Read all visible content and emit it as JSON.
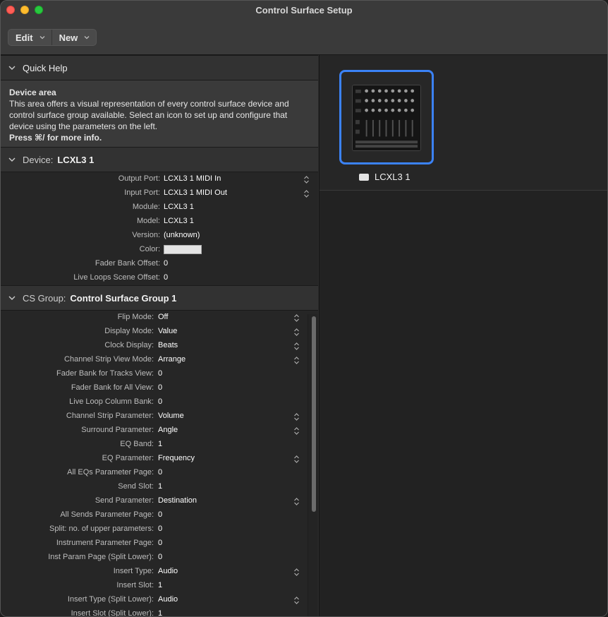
{
  "window": {
    "title": "Control Surface Setup"
  },
  "toolbar": {
    "edit_label": "Edit",
    "new_label": "New"
  },
  "quick_help": {
    "header": "Quick Help",
    "title": "Device area",
    "body": "This area offers a visual representation of every control surface device and control surface group available. Select an icon to set up and configure that device using the parameters on the left.",
    "footer": "Press ⌘/ for more info."
  },
  "device_section": {
    "label": "Device:",
    "value": "LCXL3 1",
    "rows": [
      {
        "key": "Output Port:",
        "value": "LCXL3 1 MIDI In",
        "stepper": true
      },
      {
        "key": "Input Port:",
        "value": "LCXL3 1 MIDI Out",
        "stepper": true
      },
      {
        "key": "Module:",
        "value": "LCXL3 1",
        "stepper": false
      },
      {
        "key": "Model:",
        "value": "LCXL3 1",
        "stepper": false
      },
      {
        "key": "Version:",
        "value": "(unknown)",
        "stepper": false
      },
      {
        "key": "Color:",
        "value": "",
        "stepper": false
      },
      {
        "key": "Fader Bank Offset:",
        "value": "0",
        "stepper": false
      },
      {
        "key": "Live Loops Scene Offset:",
        "value": "0",
        "stepper": false
      }
    ]
  },
  "group_section": {
    "label": "CS Group:",
    "value": "Control Surface Group 1",
    "rows": [
      {
        "key": "Flip Mode:",
        "value": "Off",
        "stepper": true
      },
      {
        "key": "Display Mode:",
        "value": "Value",
        "stepper": true
      },
      {
        "key": "Clock Display:",
        "value": "Beats",
        "stepper": true
      },
      {
        "key": "Channel Strip View Mode:",
        "value": "Arrange",
        "stepper": true
      },
      {
        "key": "Fader Bank for Tracks View:",
        "value": "0",
        "stepper": false
      },
      {
        "key": "Fader Bank for All View:",
        "value": "0",
        "stepper": false
      },
      {
        "key": "Live Loop Column Bank:",
        "value": "0",
        "stepper": false
      },
      {
        "key": "Channel Strip Parameter:",
        "value": "Volume",
        "stepper": true
      },
      {
        "key": "Surround Parameter:",
        "value": "Angle",
        "stepper": true
      },
      {
        "key": "EQ Band:",
        "value": "1",
        "stepper": false
      },
      {
        "key": "EQ Parameter:",
        "value": "Frequency",
        "stepper": true
      },
      {
        "key": "All EQs Parameter Page:",
        "value": "0",
        "stepper": false
      },
      {
        "key": "Send Slot:",
        "value": "1",
        "stepper": false
      },
      {
        "key": "Send Parameter:",
        "value": "Destination",
        "stepper": true
      },
      {
        "key": "All Sends Parameter Page:",
        "value": "0",
        "stepper": false
      },
      {
        "key": "Split: no. of upper parameters:",
        "value": "0",
        "stepper": false
      },
      {
        "key": "Instrument Parameter Page:",
        "value": "0",
        "stepper": false
      },
      {
        "key": "Inst Param Page (Split Lower):",
        "value": "0",
        "stepper": false
      },
      {
        "key": "Insert Type:",
        "value": "Audio",
        "stepper": true
      },
      {
        "key": "Insert Slot:",
        "value": "1",
        "stepper": false
      },
      {
        "key": "Insert Type (Split Lower):",
        "value": "Audio",
        "stepper": true
      },
      {
        "key": "Insert Slot (Split Lower):",
        "value": "1",
        "stepper": false
      }
    ]
  },
  "device_area": {
    "device_name": "LCXL3 1",
    "selection_color": "#3b82f6"
  }
}
